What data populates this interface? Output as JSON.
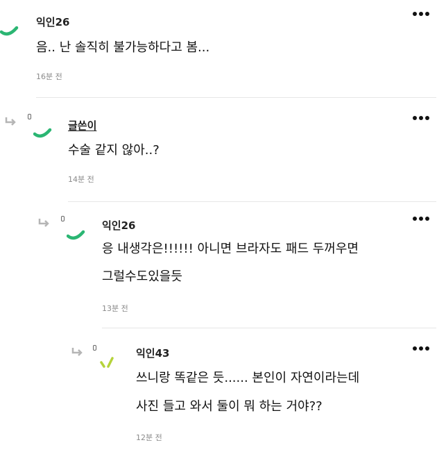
{
  "colors": {
    "avatar_green": "#2bb673",
    "avatar_yellowgreen": "#b5d33a",
    "text": "#111111",
    "muted": "#8a8a8a"
  },
  "comments": [
    {
      "author": "익인26",
      "text_lines": [
        "음.. 난 솔직히 불가능하다고 봄..."
      ],
      "time": "16분 전",
      "avatar_icon": "green-swoosh-icon",
      "reply_depth": 0
    },
    {
      "author": "글쓴이",
      "text_lines": [
        "수술 같지 않아..?"
      ],
      "time": "14분 전",
      "avatar_icon": "green-swoosh-icon",
      "reply_depth": 1,
      "is_op": true
    },
    {
      "author": "익인26",
      "text_lines": [
        "응 내생각은!!!!!! 아니면 브라자도 패드 두꺼우면",
        "그럴수도있을듯"
      ],
      "time": "13분 전",
      "avatar_icon": "green-swoosh-icon",
      "reply_depth": 2
    },
    {
      "author": "익인43",
      "text_lines": [
        "쓰니랑 똑같은 듯...... 본인이 자연이라는데",
        "사진 들고 와서 둘이 뭐 하는 거야??"
      ],
      "time": "12분 전",
      "avatar_icon": "yellow-green-dashes-icon",
      "reply_depth": 3
    }
  ]
}
